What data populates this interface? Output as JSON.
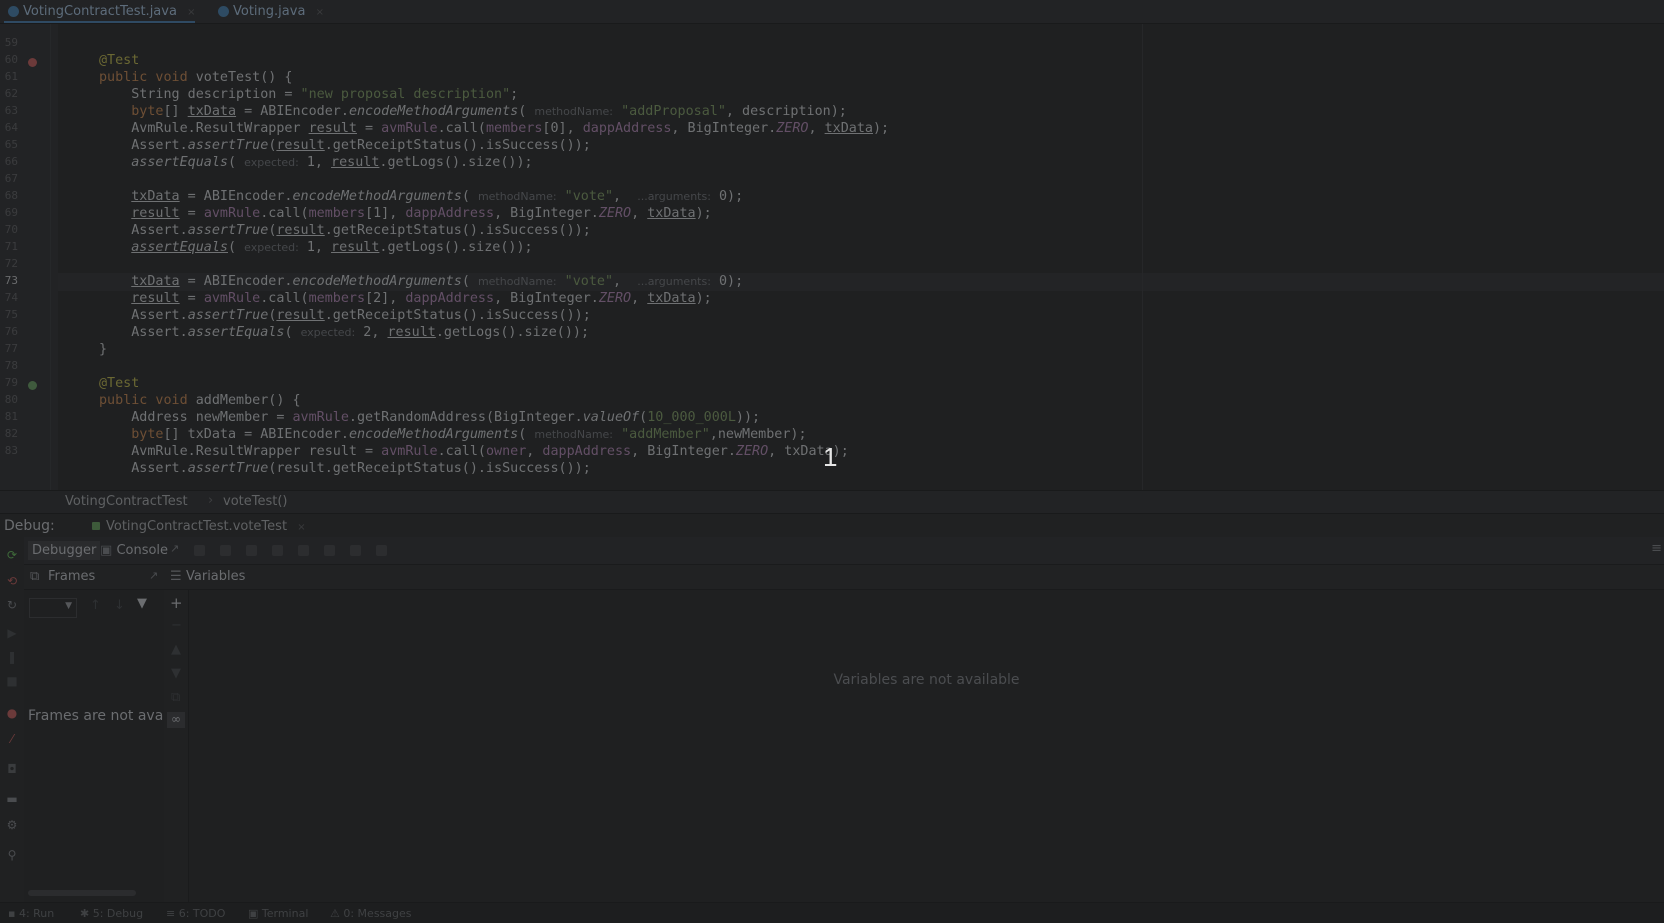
{
  "tabs": [
    {
      "label": "VotingContractTest.java",
      "close": "×"
    },
    {
      "label": "Voting.java",
      "close": "×"
    }
  ],
  "editor": {
    "current_line": "73",
    "line_numbers": [
      "59",
      "60",
      "61",
      "62",
      "63",
      "64",
      "65",
      "66",
      "67",
      "68",
      "69",
      "70",
      "71",
      "72",
      "73",
      "74",
      "75",
      "76",
      "77",
      "78",
      "79",
      "80",
      "81",
      "82",
      "83"
    ],
    "overlay_marker": "1"
  },
  "breadcrumb": {
    "class": "VotingContractTest",
    "method": "voteTest()"
  },
  "debug": {
    "label": "Debug:",
    "run_config": "VotingContractTest.voteTest",
    "close": "×",
    "tabs": {
      "debugger": "Debugger",
      "console": "Console"
    },
    "frames_title": "Frames",
    "variables_title": "Variables",
    "frames_empty": "Frames are not avail",
    "variables_empty": "Variables are not available"
  },
  "icons": {
    "resume": "resume-icon",
    "stop": "stop-icon",
    "filter": "filter-icon",
    "add": "add-watch-icon",
    "settings": "gear-icon",
    "pin": "pin-icon"
  },
  "colors": {
    "background": "#1f2021",
    "keyword": "#6e4f35",
    "annotation": "#6b6833",
    "string": "#4b5a3f",
    "field": "#634f66"
  }
}
